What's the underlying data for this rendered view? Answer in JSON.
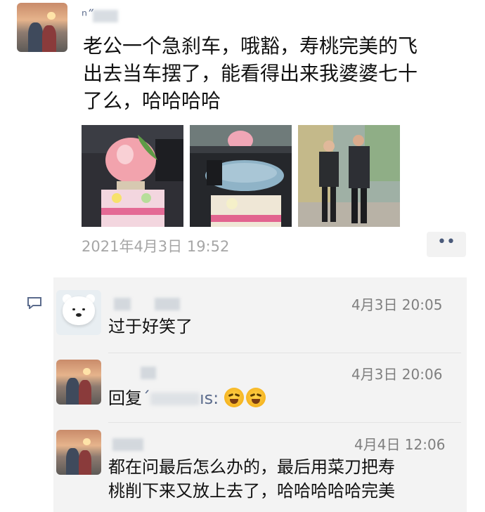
{
  "post": {
    "author_name": "ⁿ˝",
    "text_lines": [
      "老公一个急刹车，哦豁，寿桃完美的飞",
      "出去当车摆了，能看得出来我婆婆七十",
      "了么，哈哈哈哈"
    ],
    "timestamp": "2021年4月3日 19:52",
    "more_label": "••",
    "photos": [
      "peach-cake-photo",
      "fallen-cake-photo",
      "elderly-couple-photo"
    ]
  },
  "comments": [
    {
      "author_name": "",
      "time": "4月3日 20:05",
      "text": "过于好笑了",
      "avatar": "polar-bear-avatar"
    },
    {
      "author_name": "",
      "time": "4月3日 20:06",
      "reply_prefix": "回复",
      "reply_target": "ˊ",
      "reply_tail": "ıs:",
      "emojis": [
        "laughing-crying-emoji",
        "laughing-crying-emoji"
      ],
      "avatar": "sunset-couple-avatar"
    },
    {
      "author_name": "",
      "time": "4月4日 12:06",
      "text_lines": [
        "都在问最后怎么办的，最后用菜刀把寿",
        "桃削下来又放上去了，哈哈哈哈哈完美"
      ],
      "avatar": "sunset-couple-avatar"
    }
  ],
  "colors": {
    "timestamp": "#a6a6a6",
    "comment_bg": "#f3f3f3",
    "more_dots": "#4a5a7a"
  }
}
